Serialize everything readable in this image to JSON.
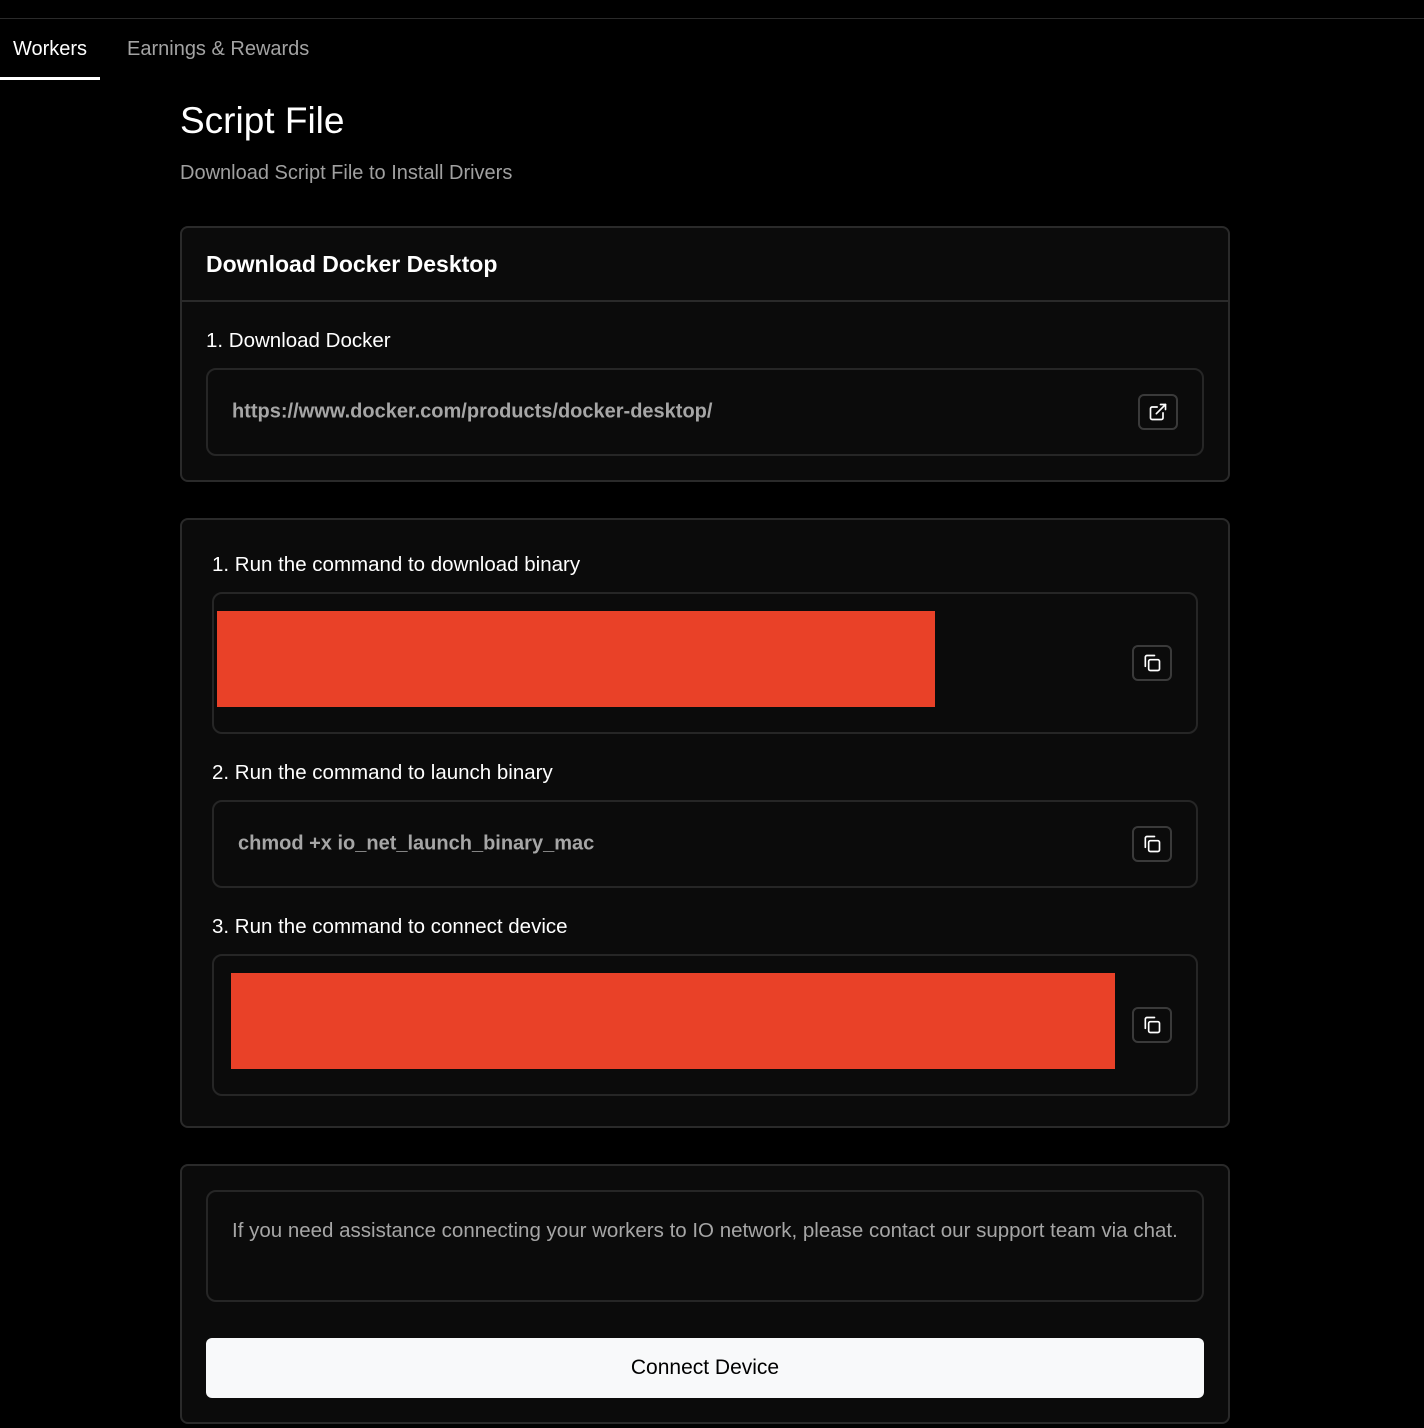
{
  "tabs": [
    {
      "label": "Workers",
      "active": true
    },
    {
      "label": "Earnings & Rewards",
      "active": false
    }
  ],
  "page": {
    "title": "Script File",
    "subtitle": "Download Script File to Install Drivers"
  },
  "docker_card": {
    "header": "Download Docker Desktop",
    "step_label": "1. Download Docker",
    "url": "https://www.docker.com/products/docker-desktop/",
    "action_icon": "external-link-icon"
  },
  "commands_card": {
    "steps": [
      {
        "label": "1. Run the command to download binary",
        "value": "",
        "redacted": true,
        "action_icon": "copy-icon"
      },
      {
        "label": "2. Run the command to launch binary",
        "value": "chmod +x io_net_launch_binary_mac",
        "redacted": false,
        "action_icon": "copy-icon"
      },
      {
        "label": "3. Run the command to connect device",
        "value": "",
        "redacted": true,
        "action_icon": "copy-icon"
      }
    ]
  },
  "support_card": {
    "notice": "If you need assistance connecting your workers to IO network, please contact our support team via chat.",
    "button_label": "Connect Device"
  },
  "colors": {
    "background": "#000000",
    "card": "#0b0b0b",
    "border": "#2a2a2a",
    "redaction": "#e94128",
    "button": "#f8f9fa"
  }
}
